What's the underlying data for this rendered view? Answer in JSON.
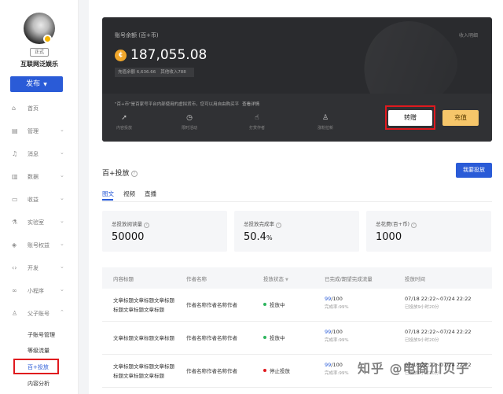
{
  "sidebar": {
    "badge": "正式",
    "username": "互联网泛娱乐",
    "publish_label": "发布",
    "nav": [
      {
        "label": "首页",
        "icon": "home-icon",
        "expandable": false
      },
      {
        "label": "管理",
        "icon": "manage-icon",
        "expandable": true
      },
      {
        "label": "消息",
        "icon": "bell-icon",
        "expandable": true
      },
      {
        "label": "数据",
        "icon": "chart-icon",
        "expandable": true
      },
      {
        "label": "收益",
        "icon": "wallet-icon",
        "expandable": true
      },
      {
        "label": "实验室",
        "icon": "flask-icon",
        "expandable": true
      },
      {
        "label": "账号权益",
        "icon": "shield-icon",
        "expandable": true
      },
      {
        "label": "开发",
        "icon": "code-icon",
        "expandable": true
      },
      {
        "label": "小程序",
        "icon": "miniapp-icon",
        "expandable": true
      },
      {
        "label": "父子账号",
        "icon": "user-icon",
        "expandable": true
      }
    ],
    "subitems": [
      "子账号管理",
      "等级流量",
      "百+投放",
      "内容分析"
    ]
  },
  "balance": {
    "title": "账号余额 (百+币)",
    "link": "收入明细",
    "amount": "187,055.08",
    "recharge": "充值余额 6,636.66",
    "other": "其他收入788",
    "desc": "\"百+币\"是百家号平台内部使用的虚拟货币，您可以用自由购买平",
    "desc_more": "查看详情",
    "perks": [
      {
        "label": "内容投放",
        "icon": "rocket-icon"
      },
      {
        "label": "限时活动",
        "icon": "clock-icon"
      },
      {
        "label": "打赏作者",
        "icon": "thumb-icon"
      },
      {
        "label": "涨粉拉新",
        "icon": "person-add-icon"
      }
    ],
    "transfer_label": "转赠",
    "recharge_label": "充值"
  },
  "section": {
    "title": "百+投放",
    "button": "我要投放",
    "tabs": [
      "图文",
      "视频",
      "直播"
    ]
  },
  "stats": [
    {
      "label": "总投放阅读量",
      "value": "50000",
      "suffix": ""
    },
    {
      "label": "总投放完成率",
      "value": "50.4",
      "suffix": "%"
    },
    {
      "label": "总花费(百+币)",
      "value": "1000",
      "suffix": ""
    }
  ],
  "table": {
    "headers": [
      "内容标题",
      "作者名称",
      "投放状态",
      "已完成/期望完成流量",
      "投放时间"
    ],
    "rows": [
      {
        "title1": "文章标题文章标题文章标题",
        "title2": "标题文章标题文章标题",
        "author": "作者名称作者名称作者",
        "status": "投放中",
        "status_color": "#2db55d",
        "done": "99",
        "total": "/100",
        "rate": "完成率:99%",
        "time": "07/18 22:22~07/24 22:22",
        "remain": "已投放9小时20分"
      },
      {
        "title1": "文章标题文章标题文章标题",
        "title2": "",
        "author": "作者名称作者名称作者",
        "status": "投放中",
        "status_color": "#2db55d",
        "done": "99",
        "total": "/100",
        "rate": "完成率:99%",
        "time": "07/18 22:22~07/24 22:22",
        "remain": "已投放9小时20分"
      },
      {
        "title1": "文章标题文章标题文章标题",
        "title2": "标题文章标题文章标题",
        "author": "作者名称作者名称作者",
        "status": "停止投放",
        "status_color": "#e0191e",
        "done": "99",
        "total": "/100",
        "rate": "完成率:99%",
        "time": "07/18 22:22~07/24 22:22",
        "remain": "已投放9小时20分"
      }
    ]
  },
  "watermark": "知乎 @电商川贝子"
}
